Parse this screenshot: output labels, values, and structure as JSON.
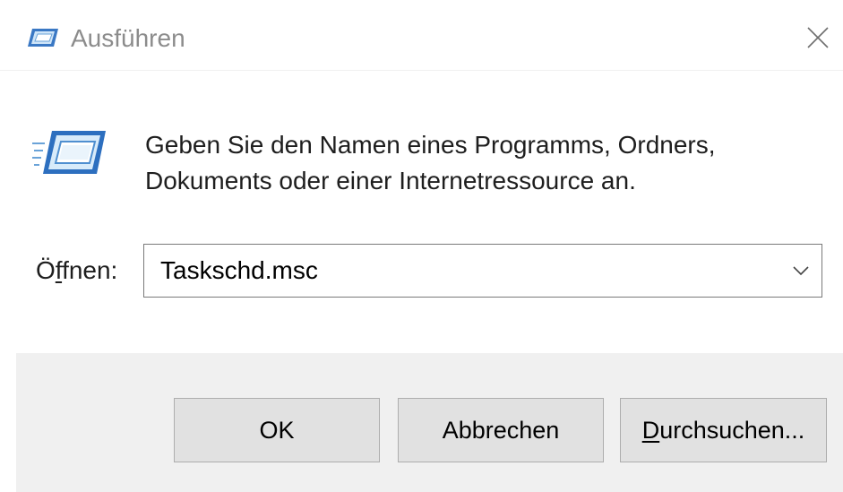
{
  "window": {
    "title": "Ausführen",
    "icon": "run-dialog-icon",
    "close_icon": "close-icon"
  },
  "description": {
    "line1": "Geben Sie den Namen eines Programms, Ordners,",
    "line2": "Dokuments oder einer Internetressource an."
  },
  "open_field": {
    "label_prefix": "Ö",
    "label_accel": "f",
    "label_suffix": "fnen:",
    "value": "Taskschd.msc"
  },
  "buttons": {
    "ok": "OK",
    "cancel": "Abbrechen",
    "browse_accel": "D",
    "browse_rest": "urchsuchen..."
  }
}
